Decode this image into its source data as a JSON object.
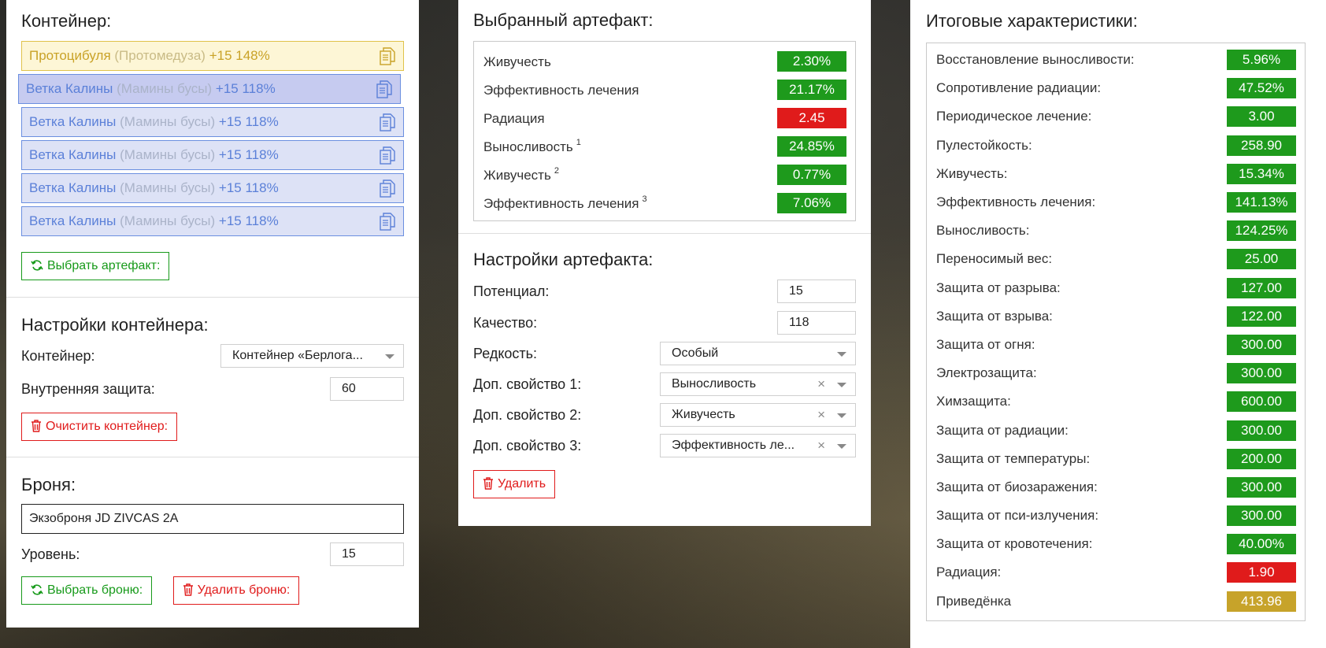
{
  "container": {
    "title": "Контейнер:",
    "slots": [
      {
        "name": "Протоцибуля",
        "alt": "(Протомедуза)",
        "level": "+15 148%"
      },
      {
        "name": "Ветка Калины",
        "alt": "(Мамины бусы)",
        "level": "+15 118%"
      },
      {
        "name": "Ветка Калины",
        "alt": "(Мамины бусы)",
        "level": "+15 118%"
      },
      {
        "name": "Ветка Калины",
        "alt": "(Мамины бусы)",
        "level": "+15 118%"
      },
      {
        "name": "Ветка Калины",
        "alt": "(Мамины бусы)",
        "level": "+15 118%"
      },
      {
        "name": "Ветка Калины",
        "alt": "(Мамины бусы)",
        "level": "+15 118%"
      }
    ],
    "select_button": "Выбрать артефакт:"
  },
  "container_settings": {
    "title": "Настройки контейнера:",
    "container_label": "Контейнер:",
    "container_value": "Контейнер «Берлога...",
    "protection_label": "Внутренняя защита:",
    "protection_value": "60",
    "clear_button": "Очистить контейнер:"
  },
  "armor": {
    "title": "Броня:",
    "name": "Экзоброня JD ZIVCAS 2A",
    "level_label": "Уровень:",
    "level_value": "15",
    "select_button": "Выбрать броню:",
    "delete_button": "Удалить броню:"
  },
  "selected_artifact": {
    "title": "Выбранный артефакт:",
    "stats": [
      {
        "label": "Живучесть",
        "sup": "",
        "value": "2.30%",
        "color": "green"
      },
      {
        "label": "Эффективность лечения",
        "sup": "",
        "value": "21.17%",
        "color": "green"
      },
      {
        "label": "Радиация",
        "sup": "",
        "value": "2.45",
        "color": "red"
      },
      {
        "label": "Выносливость",
        "sup": "1",
        "value": "24.85%",
        "color": "green"
      },
      {
        "label": "Живучесть",
        "sup": "2",
        "value": "0.77%",
        "color": "green"
      },
      {
        "label": "Эффективность лечения",
        "sup": "3",
        "value": "7.06%",
        "color": "green"
      }
    ]
  },
  "artifact_settings": {
    "title": "Настройки артефакта:",
    "potential_label": "Потенциал:",
    "potential_value": "15",
    "quality_label": "Качество:",
    "quality_value": "118",
    "rarity_label": "Редкость:",
    "rarity_value": "Особый",
    "extra1_label": "Доп. свойство 1:",
    "extra1_value": "Выносливость",
    "extra2_label": "Доп. свойство 2:",
    "extra2_value": "Живучесть",
    "extra3_label": "Доп. свойство 3:",
    "extra3_value": "Эффективность ле...",
    "clear_symbol": "×",
    "delete_button": "Удалить"
  },
  "totals": {
    "title": "Итоговые характеристики:",
    "stats": [
      {
        "label": "Восстановление выносливости:",
        "value": "5.96%",
        "color": "green"
      },
      {
        "label": "Сопротивление радиации:",
        "value": "47.52%",
        "color": "green"
      },
      {
        "label": "Периодическое лечение:",
        "value": "3.00",
        "color": "green"
      },
      {
        "label": "Пулестойкость:",
        "value": "258.90",
        "color": "green"
      },
      {
        "label": "Живучесть:",
        "value": "15.34%",
        "color": "green"
      },
      {
        "label": "Эффективность лечения:",
        "value": "141.13%",
        "color": "green"
      },
      {
        "label": "Выносливость:",
        "value": "124.25%",
        "color": "green"
      },
      {
        "label": "Переносимый вес:",
        "value": "25.00",
        "color": "green"
      },
      {
        "label": "Защита от разрыва:",
        "value": "127.00",
        "color": "green"
      },
      {
        "label": "Защита от взрыва:",
        "value": "122.00",
        "color": "green"
      },
      {
        "label": "Защита от огня:",
        "value": "300.00",
        "color": "green"
      },
      {
        "label": "Электрозащита:",
        "value": "300.00",
        "color": "green"
      },
      {
        "label": "Химзащита:",
        "value": "600.00",
        "color": "green"
      },
      {
        "label": "Защита от радиации:",
        "value": "300.00",
        "color": "green"
      },
      {
        "label": "Защита от температуры:",
        "value": "200.00",
        "color": "green"
      },
      {
        "label": "Защита от биозаражения:",
        "value": "300.00",
        "color": "green"
      },
      {
        "label": "Защита от пси-излучения:",
        "value": "300.00",
        "color": "green"
      },
      {
        "label": "Защита от кровотечения:",
        "value": "40.00%",
        "color": "green"
      },
      {
        "label": "Радиация:",
        "value": "1.90",
        "color": "red"
      },
      {
        "label": "Приведёнка",
        "value": "413.96",
        "color": "gold"
      }
    ]
  },
  "colors": {
    "green": "#1e9a1c",
    "red": "#e01b1b",
    "gold": "#c7a32a",
    "slot_blue": "#5b80d8",
    "slot_gold": "#c9a227"
  },
  "icons": {
    "slot_action": "copy-icon",
    "refresh": "refresh-icon",
    "delete": "trash-icon",
    "dropdown": "chevron-down-icon"
  }
}
